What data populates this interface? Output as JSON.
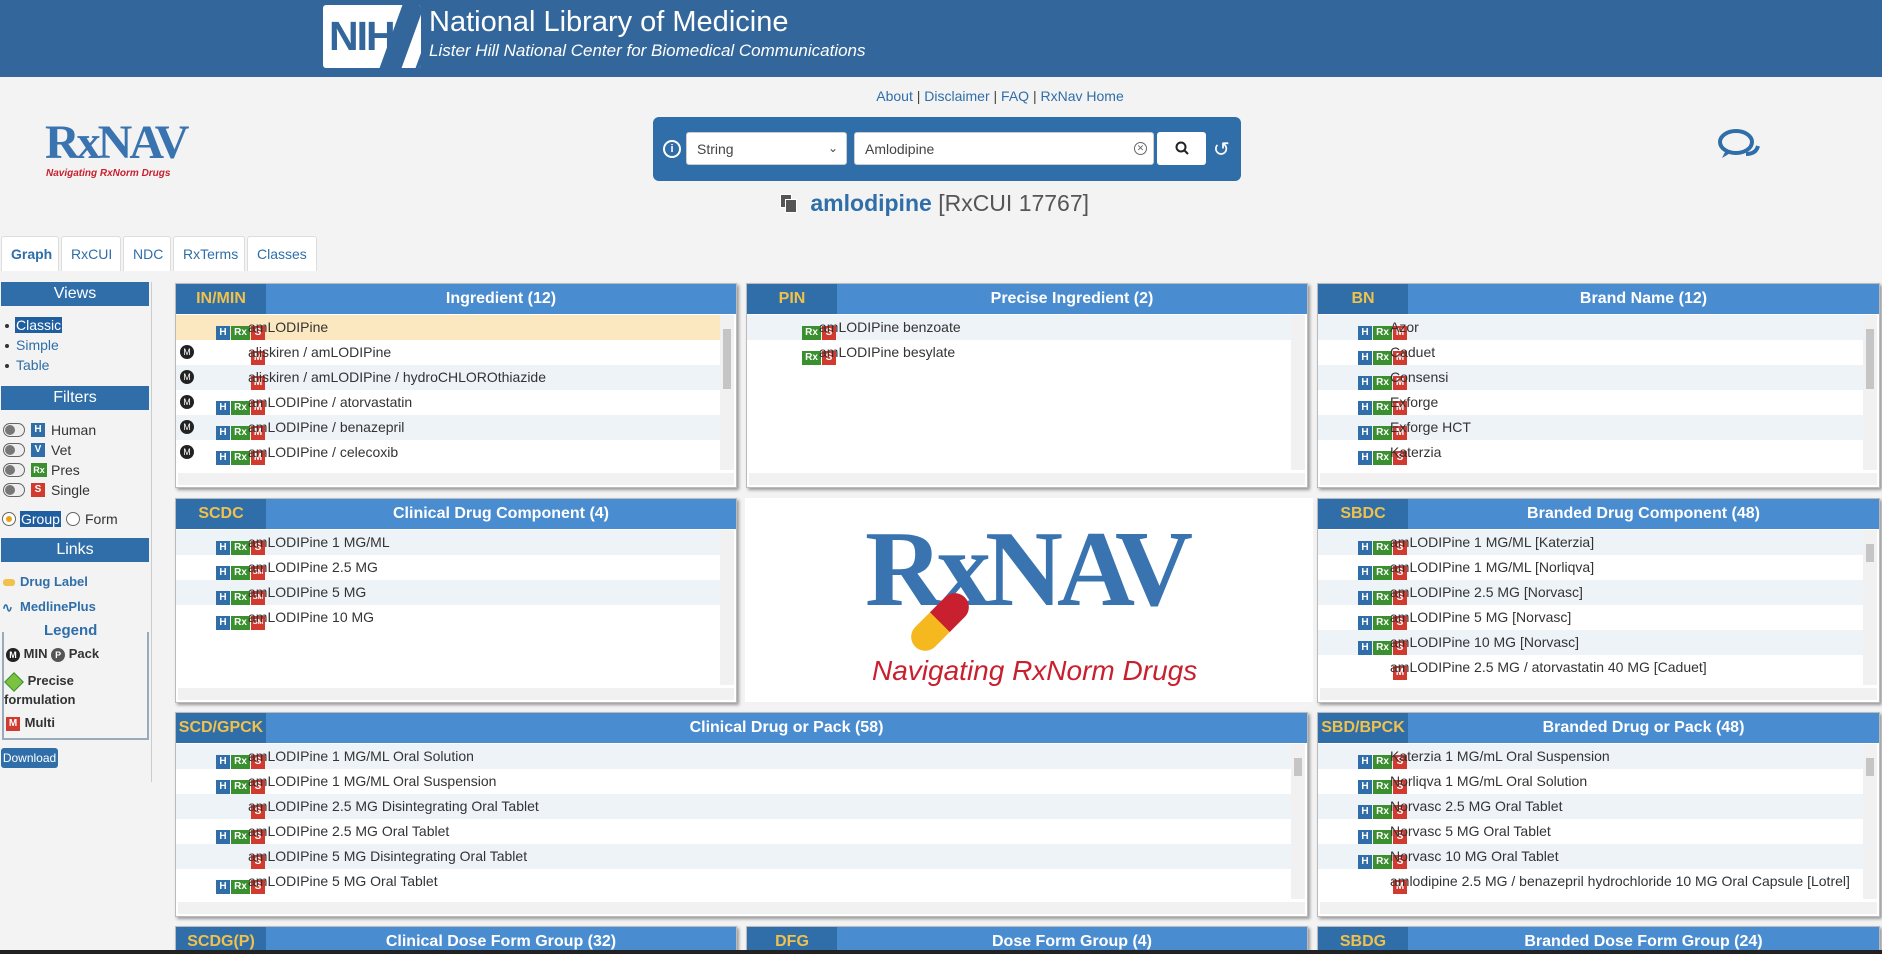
{
  "banner": {
    "agency": "NIH",
    "title": "National Library of Medicine",
    "subtitle": "Lister Hill National Center for Biomedical Communications"
  },
  "top_links": [
    "About",
    "Disclaimer",
    "FAQ",
    "RxNav Home"
  ],
  "logo": {
    "name": "RxNAV",
    "tagline": "Navigating RxNorm Drugs"
  },
  "search": {
    "type": "String",
    "value": "Amlodipine"
  },
  "result": {
    "name": "amlodipine",
    "rxcui": "[RxCUI 17767]"
  },
  "tabs": [
    "Graph",
    "RxCUI",
    "NDC",
    "RxTerms",
    "Classes"
  ],
  "sidebar": {
    "views_title": "Views",
    "views": [
      "Classic",
      "Simple",
      "Table"
    ],
    "filters_title": "Filters",
    "filters": [
      {
        "flag": "H",
        "label": "Human"
      },
      {
        "flag": "V",
        "label": "Vet"
      },
      {
        "flag": "Rx",
        "label": "Pres"
      },
      {
        "flag": "S",
        "label": "Single"
      }
    ],
    "group_label": "Group",
    "form_label": "Form",
    "links_title": "Links",
    "links": [
      "Drug Label",
      "MedlinePlus"
    ],
    "legend_title": "Legend",
    "legend_min": "MIN",
    "legend_pack": "Pack",
    "legend_precise": "Precise formulation",
    "legend_multi": "Multi",
    "download": "Download"
  },
  "panels": {
    "in": {
      "code": "IN/MIN",
      "title": "Ingredient (12)",
      "rows": [
        {
          "min": false,
          "flags": [
            "H",
            "Rx",
            "S"
          ],
          "text": "amLODIPine"
        },
        {
          "min": true,
          "flags": [
            "M"
          ],
          "text": "aliskiren / amLODIPine"
        },
        {
          "min": true,
          "flags": [
            "M"
          ],
          "text": "aliskiren / amLODIPine / hydroCHLOROthiazide"
        },
        {
          "min": true,
          "flags": [
            "H",
            "Rx",
            "M"
          ],
          "text": "amLODIPine / atorvastatin"
        },
        {
          "min": true,
          "flags": [
            "H",
            "Rx",
            "M"
          ],
          "text": "amLODIPine / benazepril"
        },
        {
          "min": true,
          "flags": [
            "H",
            "Rx",
            "M"
          ],
          "text": "amLODIPine / celecoxib"
        }
      ]
    },
    "pin": {
      "code": "PIN",
      "title": "Precise Ingredient (2)",
      "rows": [
        {
          "flags": [
            "Rx",
            "S"
          ],
          "text": "amLODIPine benzoate"
        },
        {
          "flags": [
            "Rx",
            "S"
          ],
          "text": "amLODIPine besylate"
        }
      ]
    },
    "bn": {
      "code": "BN",
      "title": "Brand Name (12)",
      "rows": [
        {
          "flags": [
            "H",
            "Rx",
            "M"
          ],
          "text": "Azor"
        },
        {
          "flags": [
            "H",
            "Rx",
            "M"
          ],
          "text": "Caduet"
        },
        {
          "flags": [
            "H",
            "Rx",
            "M"
          ],
          "text": "Consensi"
        },
        {
          "flags": [
            "H",
            "Rx",
            "M"
          ],
          "text": "Exforge"
        },
        {
          "flags": [
            "H",
            "Rx",
            "M"
          ],
          "text": "Exforge HCT"
        },
        {
          "flags": [
            "H",
            "Rx",
            "S"
          ],
          "text": "Katerzia"
        }
      ]
    },
    "scdc": {
      "code": "SCDC",
      "title": "Clinical Drug Component (4)",
      "rows": [
        {
          "flags": [
            "H",
            "Rx",
            "S"
          ],
          "text": "amLODIPine 1 MG/ML"
        },
        {
          "flags": [
            "H",
            "Rx",
            "SM"
          ],
          "text": "amLODIPine 2.5 MG"
        },
        {
          "flags": [
            "H",
            "Rx",
            "SM"
          ],
          "text": "amLODIPine 5 MG"
        },
        {
          "flags": [
            "H",
            "Rx",
            "SM"
          ],
          "text": "amLODIPine 10 MG"
        }
      ]
    },
    "sbdc": {
      "code": "SBDC",
      "title": "Branded Drug Component (48)",
      "rows": [
        {
          "flags": [
            "H",
            "Rx",
            "S"
          ],
          "text": "amLODIPine 1 MG/ML [Katerzia]"
        },
        {
          "flags": [
            "H",
            "Rx",
            "S"
          ],
          "text": "amLODIPine 1 MG/ML [Norliqva]"
        },
        {
          "flags": [
            "H",
            "Rx",
            "S"
          ],
          "text": "amLODIPine 2.5 MG [Norvasc]"
        },
        {
          "flags": [
            "H",
            "Rx",
            "S"
          ],
          "text": "amLODIPine 5 MG [Norvasc]"
        },
        {
          "flags": [
            "H",
            "Rx",
            "S"
          ],
          "text": "amLODIPine 10 MG [Norvasc]"
        },
        {
          "flags": [
            "M"
          ],
          "text": "amLODIPine 2.5 MG / atorvastatin 40 MG [Caduet]"
        }
      ]
    },
    "scd": {
      "code": "SCD/GPCK",
      "title": "Clinical Drug or Pack (58)",
      "rows": [
        {
          "flags": [
            "H",
            "Rx",
            "S"
          ],
          "text": "amLODIPine 1 MG/ML Oral Solution"
        },
        {
          "flags": [
            "H",
            "Rx",
            "S"
          ],
          "text": "amLODIPine 1 MG/ML Oral Suspension"
        },
        {
          "flags": [
            "S"
          ],
          "text": "amLODIPine 2.5 MG Disintegrating Oral Tablet"
        },
        {
          "flags": [
            "H",
            "Rx",
            "S"
          ],
          "text": "amLODIPine 2.5 MG Oral Tablet"
        },
        {
          "flags": [
            "S"
          ],
          "text": "amLODIPine 5 MG Disintegrating Oral Tablet"
        },
        {
          "flags": [
            "H",
            "Rx",
            "S"
          ],
          "text": "amLODIPine 5 MG Oral Tablet"
        }
      ]
    },
    "sbd": {
      "code": "SBD/BPCK",
      "title": "Branded Drug or Pack (48)",
      "rows": [
        {
          "flags": [
            "H",
            "Rx",
            "S"
          ],
          "text": "Katerzia 1 MG/mL Oral Suspension"
        },
        {
          "flags": [
            "H",
            "Rx",
            "S"
          ],
          "text": "Norliqva 1 MG/mL Oral Solution"
        },
        {
          "flags": [
            "H",
            "Rx",
            "S"
          ],
          "text": "Norvasc 2.5 MG Oral Tablet"
        },
        {
          "flags": [
            "H",
            "Rx",
            "S"
          ],
          "text": "Norvasc 5 MG Oral Tablet"
        },
        {
          "flags": [
            "H",
            "Rx",
            "S"
          ],
          "text": "Norvasc 10 MG Oral Tablet"
        },
        {
          "flags": [
            "M"
          ],
          "text": "amlodipine 2.5 MG / benazepril hydrochloride 10 MG Oral Capsule [Lotrel]"
        }
      ]
    },
    "scdg": {
      "code": "SCDG(P)",
      "title": "Clinical Dose Form Group (32)"
    },
    "dfg": {
      "code": "DFG",
      "title": "Dose Form Group (4)"
    },
    "sbdg": {
      "code": "SBDG",
      "title": "Branded Dose Form Group (24)"
    }
  },
  "center_logo": {
    "name": "RxNAV",
    "tagline": "Navigating RxNorm Drugs"
  }
}
